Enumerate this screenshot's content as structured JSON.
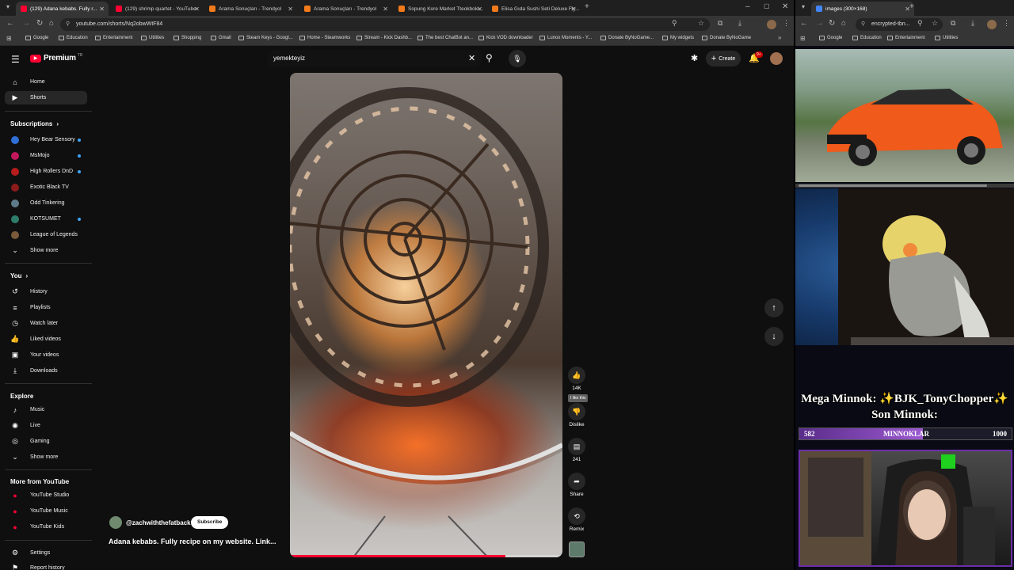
{
  "browser_left": {
    "tabs": [
      {
        "title": "(129) Adana kebabs. Fully r...",
        "active": true,
        "color": "#ff0033"
      },
      {
        "title": "(129) shrimp quartet - YouTube",
        "active": false,
        "color": "#ff0033"
      },
      {
        "title": "Arama Sonuçları - Trendyol",
        "active": false,
        "color": "#f27a1a"
      },
      {
        "title": "Arama Sonuçları - Trendyol",
        "active": false,
        "color": "#f27a1a"
      },
      {
        "title": "Sopung Kore Market Tteokboki...",
        "active": false,
        "color": "#f27a1a"
      },
      {
        "title": "Elisa Gıda Sushi Seti Deluxe Fly...",
        "active": false,
        "color": "#f27a1a"
      }
    ],
    "url": "youtube.com/shorts/Nq2obwWtF84",
    "bookmarks": [
      "Google",
      "Education",
      "Entertainment",
      "Utilities",
      "Shopping",
      "Gmail",
      "Steam Keys - Googl...",
      "Home - Steamworks",
      "Stream - Kick Dashb...",
      "The best ChatBot an...",
      "Kick VOD downloader",
      "Lunox Moments - Y...",
      "Donate ByNoGame...",
      "My widgets",
      "Donate ByNoGame"
    ]
  },
  "youtube": {
    "logo": "Premium",
    "logo_sup": "TR",
    "search_value": "yemekteyiz",
    "create_label": "Create",
    "notif_count": "9+",
    "sidebar": {
      "main": [
        {
          "label": "Home",
          "icon": "home-icon",
          "glyph": "⌂"
        },
        {
          "label": "Shorts",
          "icon": "shorts-icon",
          "glyph": "▶",
          "active": true
        }
      ],
      "subscriptions_title": "Subscriptions",
      "subscriptions": [
        {
          "label": "Hey Bear Sensory",
          "color": "#2f6fd6",
          "live": true
        },
        {
          "label": "MsMojo",
          "color": "#c2185b",
          "live": true
        },
        {
          "label": "High Rollers DnD",
          "color": "#b71c1c",
          "live": true
        },
        {
          "label": "Exotic Black TV",
          "color": "#8d1b1b",
          "live": false
        },
        {
          "label": "Odd Tinkering",
          "color": "#5d7a8a",
          "live": false
        },
        {
          "label": "KOTSUMET",
          "color": "#2e7d6b",
          "live": true
        },
        {
          "label": "League of Legends",
          "color": "#7a5a3a",
          "live": false
        }
      ],
      "show_more": "Show more",
      "you_title": "You",
      "you": [
        {
          "label": "History",
          "glyph": "↺"
        },
        {
          "label": "Playlists",
          "glyph": "≡"
        },
        {
          "label": "Watch later",
          "glyph": "◷"
        },
        {
          "label": "Liked videos",
          "glyph": "👍"
        },
        {
          "label": "Your videos",
          "glyph": "▣"
        },
        {
          "label": "Downloads",
          "glyph": "⤓"
        }
      ],
      "explore_title": "Explore",
      "explore": [
        {
          "label": "Music",
          "glyph": "♪"
        },
        {
          "label": "Live",
          "glyph": "◉"
        },
        {
          "label": "Gaming",
          "glyph": "◎"
        }
      ],
      "show_more_2": "Show more",
      "more_title": "More from YouTube",
      "more": [
        {
          "label": "YouTube Studio"
        },
        {
          "label": "YouTube Music"
        },
        {
          "label": "YouTube Kids"
        }
      ],
      "settings": "Settings",
      "report": "Report history"
    },
    "short": {
      "channel": "@zachwiththefatback",
      "subscribe": "Subscribe",
      "title": "Adana kebabs. Fully recipe on my website. Link...",
      "likes": "14K",
      "tooltip": "I like this",
      "dislike": "Dislike",
      "comments": "241",
      "share": "Share",
      "remix": "Remix",
      "progress": 0.79
    }
  },
  "browser_right": {
    "tab_title": "images (300×168)",
    "url": "encrypted-tbn...",
    "bookmarks": [
      "Google",
      "Education",
      "Entertainment",
      "Utilities"
    ]
  },
  "stream_overlay": {
    "line1": "Mega Minnok: ✨BJK_TonyChopper✨",
    "line2": "Son Minnok:",
    "bar_left": "582",
    "bar_label": "MINNOKLAR",
    "bar_right": "1000",
    "bar_progress": 0.582
  }
}
